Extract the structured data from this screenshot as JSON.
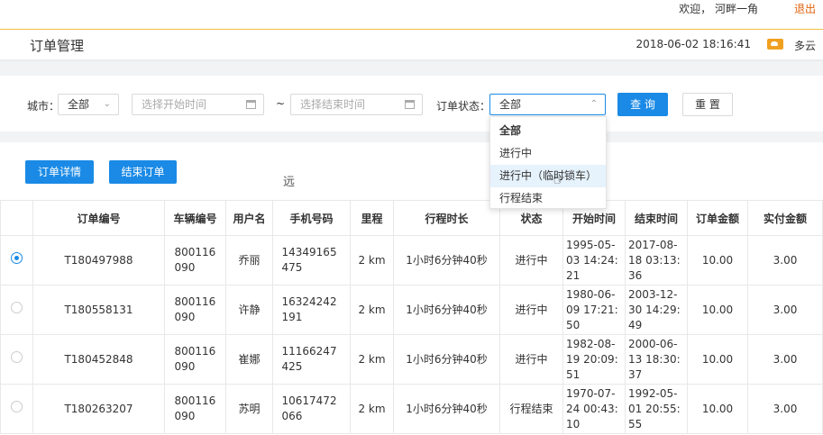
{
  "topbar": {
    "welcome": "欢迎， 河畔一角",
    "logout": "退出"
  },
  "titlebar": {
    "title": "订单管理",
    "datetime": "2018-06-02 18:16:41",
    "weather": "多云"
  },
  "filter": {
    "city_label": "城市：",
    "city_value": "全部",
    "start_placeholder": "选择开始时间",
    "tilde": "~",
    "end_placeholder": "选择结束时间",
    "status_label": "订单状态：",
    "status_value": "全部",
    "query": "查 询",
    "reset": "重 置"
  },
  "actions": {
    "detail": "订单详情",
    "finish": "结束订单",
    "hint": "远"
  },
  "status_dropdown": {
    "options": [
      "全部",
      "进行中",
      "进行中（临时锁车）",
      "行程结束"
    ]
  },
  "table": {
    "headers": [
      "订单编号",
      "车辆编号",
      "用户名",
      "手机号码",
      "里程",
      "行程时长",
      "状态",
      "开始时间",
      "结束时间",
      "订单金额",
      "实付金额"
    ],
    "rows": [
      [
        "T180497988",
        "800116090",
        "乔丽",
        "14349165475",
        "2 km",
        "1小时6分钟40秒",
        "进行中",
        "1995-05-03 14:24:21",
        "2017-08-18 03:13:36",
        "10.00",
        "3.00"
      ],
      [
        "T180558131",
        "800116090",
        "许静",
        "16324242191",
        "2 km",
        "1小时6分钟40秒",
        "进行中",
        "1980-06-09 17:21:50",
        "2003-12-30 14:29:49",
        "10.00",
        "3.00"
      ],
      [
        "T180452848",
        "800116090",
        "崔娜",
        "11166247425",
        "2 km",
        "1小时6分钟40秒",
        "进行中",
        "1982-08-19 20:09:51",
        "2000-06-13 18:30:37",
        "10.00",
        "3.00"
      ],
      [
        "T180263207",
        "800116090",
        "苏明",
        "10617472066",
        "2 km",
        "1小时6分钟40秒",
        "行程结束",
        "1970-07-24 00:43:10",
        "1992-05-01 20:55:55",
        "10.00",
        "3.00"
      ]
    ]
  }
}
